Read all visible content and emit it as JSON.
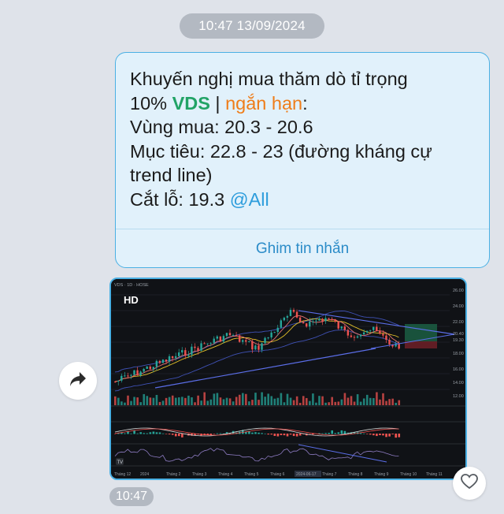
{
  "date_stamp": "10:47 13/09/2024",
  "message": {
    "line1": "Khuyến nghị mua thăm dò tỉ trọng",
    "line2_prefix": "10% ",
    "ticker": "VDS",
    "separator": " | ",
    "horizon": "ngắn hạn",
    "line2_suffix": ":",
    "buy_zone": "Vùng mua: 20.3 - 20.6",
    "target_a": "Mục tiêu: 22.8 - 23 (đường kháng cự",
    "target_b": "trend line)",
    "stop_loss_prefix": "Cắt lỗ: 19.3 ",
    "mention": "@All",
    "pin_action": "Ghim tin nhắn"
  },
  "image": {
    "badge": "HD",
    "chart_header": "VDS · 1D · HOSE",
    "price_scale": [
      "26.00",
      "24.00",
      "22.00",
      "20.40",
      "19.30",
      "18.00",
      "16.00",
      "14.00",
      "12.00"
    ],
    "time_labels": [
      "Tháng 12",
      "2024",
      "Tháng 2",
      "Tháng 3",
      "Tháng 4",
      "Tháng 5",
      "Tháng 6",
      "2024-06-17",
      "Tháng 7",
      "Tháng 8",
      "Tháng 9",
      "Tháng 10",
      "Tháng 11"
    ]
  },
  "timestamp": "10:47",
  "icons": {
    "forward": "forward-arrow-icon",
    "react": "heart-icon"
  },
  "colors": {
    "bubble_bg": "#e1f1fb",
    "bubble_border": "#4ab0e4",
    "ticker": "#21a366",
    "horizon": "#ef7d19",
    "mention": "#2d9ddc",
    "pin": "#2b8cc8",
    "chart_up": "#26a69a",
    "chart_down": "#ef5350"
  }
}
